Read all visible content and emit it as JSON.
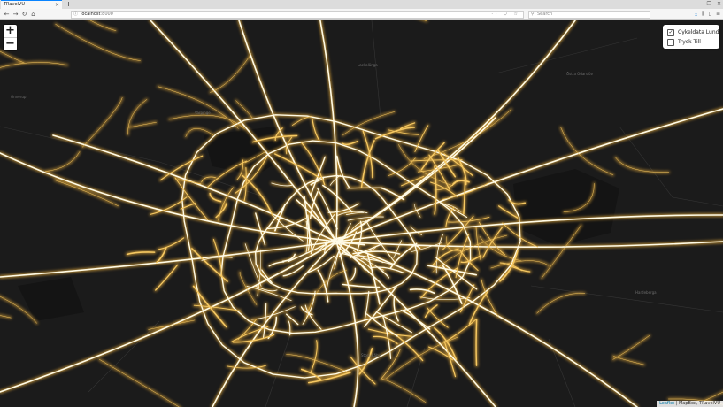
{
  "browser": {
    "tab_title": "TRavelVU",
    "tab_close": "×",
    "new_tab": "+",
    "window_controls": [
      "—",
      "❐",
      "✕"
    ],
    "url_host": "localhost",
    "url_port": ":8000",
    "url_actions": "··· ⛉ ☆",
    "search_placeholder": "Search"
  },
  "map": {
    "zoom_in": "+",
    "zoom_out": "−",
    "layers": [
      {
        "label": "Cykeldata Lund",
        "checked": true
      },
      {
        "label": "Tryck Till",
        "checked": false
      }
    ],
    "attribution_link": "Leaflet",
    "attribution_rest": " | MapBox, TRavelVU",
    "place_labels": [
      "Lackalänga",
      "Östra Odarslöv",
      "Hardeberga",
      "Stora Råby",
      "Värpinge",
      "Önnerup"
    ],
    "colors": {
      "background": "#1b1b1b",
      "route_core": "#fff8d8",
      "route_glow": "#f2b43c",
      "base_road": "#3a3a3a"
    }
  }
}
